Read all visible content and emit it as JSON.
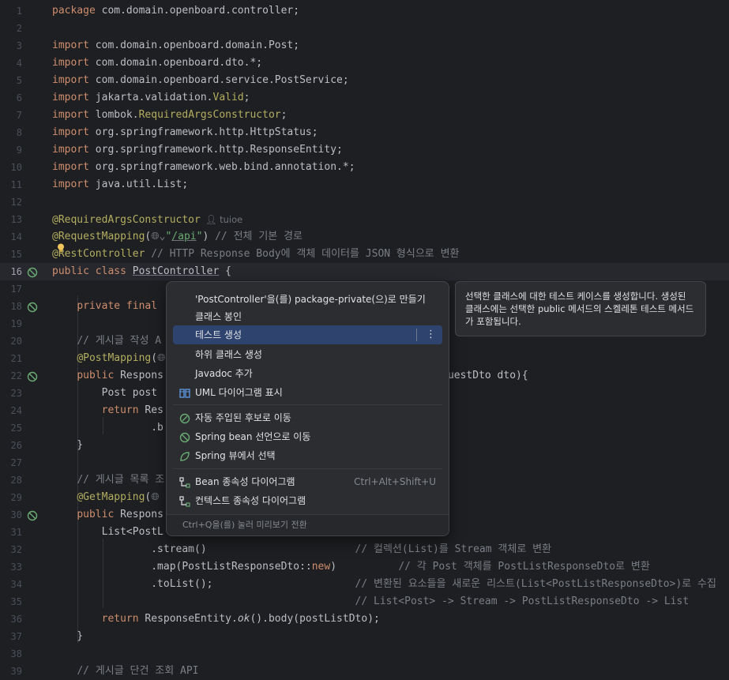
{
  "editor": {
    "lines": [
      {
        "n": "1",
        "html": "<span class=\"k\">package</span> com.domain.openboard.controller;"
      },
      {
        "n": "2",
        "html": ""
      },
      {
        "n": "3",
        "html": "<span class=\"k\">import</span> com.domain.openboard.domain.Post;"
      },
      {
        "n": "4",
        "html": "<span class=\"k\">import</span> com.domain.openboard.dto.*;"
      },
      {
        "n": "5",
        "html": "<span class=\"k\">import</span> com.domain.openboard.service.PostService;"
      },
      {
        "n": "6",
        "html": "<span class=\"k\">import</span> jakarta.validation.<span class=\"an\">Valid</span>;"
      },
      {
        "n": "7",
        "html": "<span class=\"k\">import</span> lombok.<span class=\"an\">RequiredArgsConstructor</span>;"
      },
      {
        "n": "8",
        "html": "<span class=\"k\">import</span> org.springframework.http.HttpStatus;"
      },
      {
        "n": "9",
        "html": "<span class=\"k\">import</span> org.springframework.http.ResponseEntity;"
      },
      {
        "n": "10",
        "html": "<span class=\"k\">import</span> org.springframework.web.bind.annotation.*;"
      },
      {
        "n": "11",
        "html": "<span class=\"k\">import</span> java.util.List;"
      },
      {
        "n": "12",
        "html": ""
      },
      {
        "n": "13",
        "html": "<span class=\"an\">@RequiredArgsConstructor</span><span class=\"inlay\">&#x1F464;&#xFE0E; tuioe</span>"
      },
      {
        "n": "14",
        "html": "<span class=\"an\">@RequestMapping</span>(<span class=\"cm\">&#x1F310;&#xFE0E;&#x2304;</span><span class=\"st\">\"<span class=\"u\">/api</span>\"</span>) <span class=\"cm\">// 전체 기본 경로</span>"
      },
      {
        "n": "15",
        "html": "<span class=\"an\">@RestController</span> <span class=\"cm\">// HTTP Response Body에 객체 데이터를 JSON 형식으로 변환</span>"
      },
      {
        "n": "16",
        "html": "<span class=\"k\">public class</span> <span class=\"u\">PostController</span> {"
      },
      {
        "n": "17",
        "html": ""
      },
      {
        "n": "18",
        "html": "    <span class=\"k\">private final</span>"
      },
      {
        "n": "19",
        "html": ""
      },
      {
        "n": "20",
        "html": "    <span class=\"cm\">// 게시글 작성 A</span>"
      },
      {
        "n": "21",
        "html": "    <span class=\"an\">@PostMapping</span>(<span class=\"cm\">&#x1F310;&#xFE0E;</span>"
      },
      {
        "n": "22",
        "html": "    <span class=\"k\">public</span> Respons                                <span class=\"an\">@Valid</span> PostRequestDto dto){"
      },
      {
        "n": "23",
        "html": "        Post post"
      },
      {
        "n": "24",
        "html": "        <span class=\"k\">return</span> Res"
      },
      {
        "n": "25",
        "html": "                .b"
      },
      {
        "n": "26",
        "html": "    }"
      },
      {
        "n": "27",
        "html": ""
      },
      {
        "n": "28",
        "html": "    <span class=\"cm\">// 게시글 목록 조</span>"
      },
      {
        "n": "29",
        "html": "    <span class=\"an\">@GetMapping</span>(<span class=\"cm\">&#x1F310;&#xFE0E;</span>"
      },
      {
        "n": "30",
        "html": "    <span class=\"k\">public</span> Respons                            s() {"
      },
      {
        "n": "31",
        "html": "        List&lt;PostL                             ndAll()"
      },
      {
        "n": "32",
        "html": "                .stream()                        <span class=\"cm\">// 컬렉션(List)를 Stream 객체로 변환</span>"
      },
      {
        "n": "33",
        "html": "                .map(PostListResponseDto::<span class=\"k\">new</span>)          <span class=\"cm\">// 각 Post 객체를 PostListResponseDto로 변환</span>"
      },
      {
        "n": "34",
        "html": "                .toList();                       <span class=\"cm\">// 변환된 요소들을 새로운 리스트(List&lt;PostListResponseDto&gt;)로 수집</span>"
      },
      {
        "n": "35",
        "html": "                                                 <span class=\"cm\">// List&lt;Post&gt; -&gt; Stream -&gt; PostListResponseDto -&gt; List</span>"
      },
      {
        "n": "36",
        "html": "        <span class=\"k\">return</span> ResponseEntity.<span class=\"it\">ok</span>().body(postListDto);"
      },
      {
        "n": "37",
        "html": "    }"
      },
      {
        "n": "38",
        "html": ""
      },
      {
        "n": "39",
        "html": "    <span class=\"cm\">// 게시글 단건 조회 API</span>"
      }
    ]
  },
  "gutter_icons": {
    "16": "bean-icon",
    "18": "injection-icon",
    "22": "endpoint-icon",
    "30": "endpoint-icon"
  },
  "context_menu": {
    "items": [
      {
        "label": "'PostController'을(를) package-private(으)로 만들기",
        "icon": "none"
      },
      {
        "label": "클래스 봉인",
        "icon": "none"
      },
      {
        "label": "테스트 생성",
        "icon": "none",
        "selected": true
      },
      {
        "label": "하위 클래스 생성",
        "icon": "none"
      },
      {
        "label": "Javadoc 추가",
        "icon": "none"
      },
      {
        "label": "UML 다이어그램 표시",
        "icon": "uml-icon"
      },
      {
        "label": "자동 주입된 후보로 이동",
        "icon": "autowired-icon"
      },
      {
        "label": "Spring bean 선언으로 이동",
        "icon": "spring-bean-icon"
      },
      {
        "label": "Spring 뷰에서 선택",
        "icon": "spring-leaf-icon"
      },
      {
        "label": "Bean 종속성 다이어그램",
        "icon": "diagram-icon",
        "shortcut": "Ctrl+Alt+Shift+U"
      },
      {
        "label": "컨텍스트 종속성 다이어그램",
        "icon": "diagram-icon"
      }
    ],
    "footer": "Ctrl+Q을(를) 눌러 미리보기 전환"
  },
  "tooltip": {
    "text": "선택한 클래스에 대한 테스트 케이스를 생성합니다. 생성된 클래스에는 선택한 public 메서드의 스켈레톤 테스트 메서드가 포함됩니다."
  },
  "colors": {
    "editor_bg": "#1e1f22",
    "keyword": "#cf8e6d",
    "annotation": "#b3ae60",
    "string": "#6aab73",
    "comment": "#7a7e85",
    "menu_selected": "#2e436e"
  }
}
